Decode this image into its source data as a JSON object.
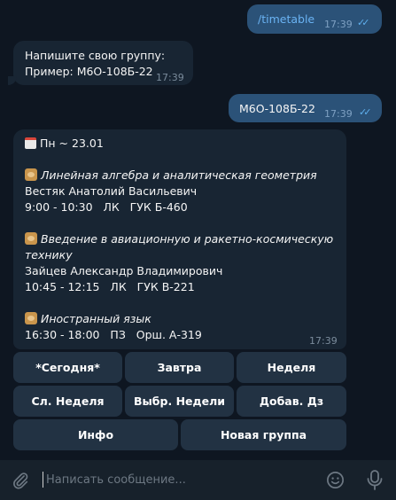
{
  "messages": {
    "m1": {
      "text": "/timetable",
      "time": "17:39"
    },
    "m2": {
      "line1": "Напишите свою группу:",
      "line2": "Пример: М6О-108Б-22",
      "time": "17:39"
    },
    "m3": {
      "text": "М6О-108Б-22",
      "time": "17:39"
    },
    "schedule": {
      "day": "Пн ~ 23.01",
      "lessons": [
        {
          "subject": "Линейная алгебра и аналитическая геометрия",
          "teacher": "Вестяк Анатолий Васильевич",
          "details": "9:00 - 10:30   ЛК   ГУК Б-460"
        },
        {
          "subject_line1": "Введение в авиационную и ракетно-космическую",
          "subject_line2": "технику",
          "teacher": "Зайцев Александр Владимирович",
          "details": "10:45 - 12:15   ЛК   ГУК В-221"
        },
        {
          "subject": "Иностранный язык",
          "details": "16:30 - 18:00   ПЗ   Орш. А-319"
        }
      ],
      "time": "17:39"
    }
  },
  "keyboard": {
    "today": "*Сегодня*",
    "tomorrow": "Завтра",
    "week": "Неделя",
    "next_week": "Сл. Неделя",
    "choose_weeks": "Выбр. Недели",
    "add_hw": "Добав. Дз",
    "info": "Инфо",
    "new_group": "Новая группа"
  },
  "composer": {
    "placeholder": "Написать сообщение..."
  },
  "colors": {
    "background": "#0e1621",
    "outgoing": "#2b5278",
    "incoming": "#182533",
    "button": "#223243",
    "link": "#6ab3f3"
  }
}
